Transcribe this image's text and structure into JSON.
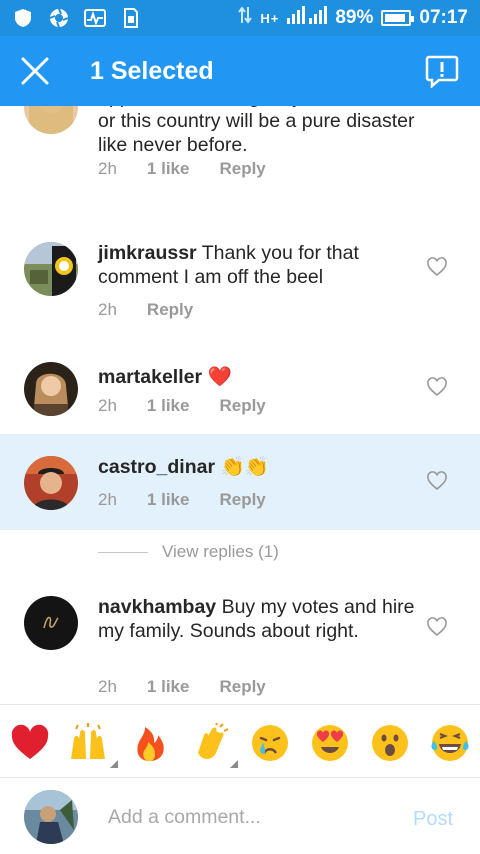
{
  "status_bar": {
    "battery": "89%",
    "battery_level": 0.89,
    "time": "07:17",
    "network": "H+",
    "icons": [
      "shield-icon",
      "aperture-icon",
      "activity-icon",
      "sim-card-icon",
      "data-arrows-icon",
      "signal-icon"
    ]
  },
  "app_bar": {
    "title": "1 Selected",
    "background": "#2196f3",
    "icons": [
      "close-icon",
      "report-icon"
    ]
  },
  "comments": [
    {
      "username": "",
      "text": "appreciated enough... you must win.. or this country will be a pure disaster like never before.",
      "time": "2h",
      "likes": "1 like",
      "reply": "Reply",
      "selected": false
    },
    {
      "username": "jimkraussr",
      "text": "Thank you for that comment I am off the beel",
      "time": "2h",
      "likes": "",
      "reply": "Reply",
      "selected": false
    },
    {
      "username": "martakeller",
      "text": "❤️",
      "time": "2h",
      "likes": "1 like",
      "reply": "Reply",
      "selected": false
    },
    {
      "username": "castro_dinar",
      "text": "👏👏",
      "time": "2h",
      "likes": "1 like",
      "reply": "Reply",
      "selected": true
    },
    {
      "username": "navkhambay",
      "text": "Buy my votes and hire my family. Sounds about right.",
      "time": "2h",
      "likes": "1 like",
      "reply": "Reply",
      "selected": false
    }
  ],
  "view_replies": "View replies (1)",
  "emoji_bar": [
    "red-heart-emoji",
    "raising-hands-emoji",
    "fire-emoji",
    "clapping-hands-emoji",
    "crying-face-emoji",
    "heart-eyes-emoji",
    "surprised-face-emoji",
    "laughing-tears-emoji"
  ],
  "composer": {
    "placeholder": "Add a comment...",
    "post": "Post"
  },
  "selection_color": "#e3f1fc"
}
